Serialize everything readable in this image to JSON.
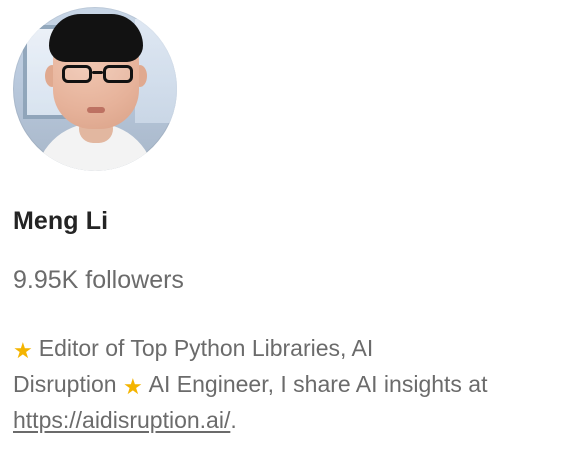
{
  "profile": {
    "name": "Meng Li",
    "followers": "9.95K followers",
    "bio": {
      "line1_prefix_icon": "star-icon",
      "line1_text": "Editor of Top Python Libraries, AI",
      "line2_text_a": "Disruption",
      "line2_icon": "star-icon",
      "line2_text_b": "AI Engineer, I share AI insights at",
      "link_text": "https://aidisruption.ai/",
      "line3_suffix": "."
    },
    "star_glyph": "★",
    "colors": {
      "primary_text": "#242424",
      "secondary_text": "#6b6b6b",
      "star": "#f4b400"
    }
  }
}
